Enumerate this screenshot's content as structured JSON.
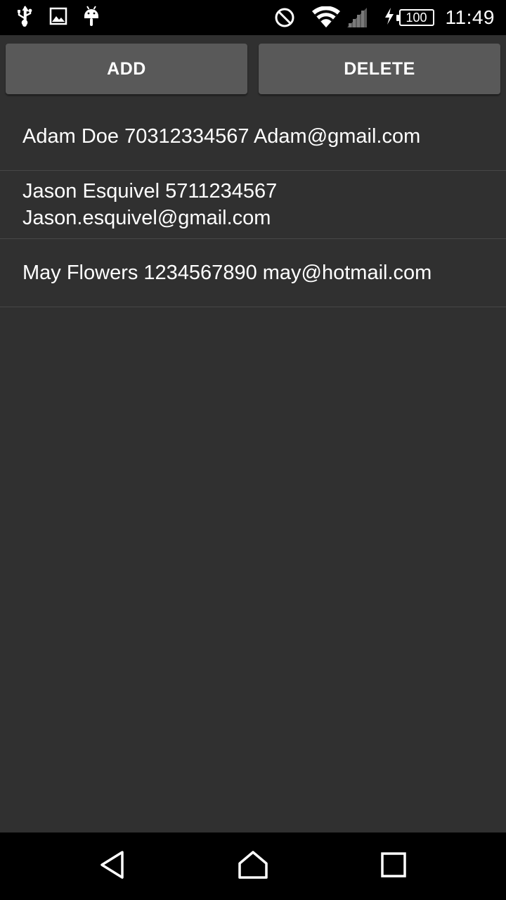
{
  "status_bar": {
    "time": "11:49",
    "battery_level": "100",
    "icons_left": [
      "usb-icon",
      "image-notification-icon",
      "android-debug-icon"
    ],
    "icons_right": [
      "do-not-disturb-icon",
      "wifi-icon",
      "cell-signal-icon",
      "charging-icon",
      "battery-icon"
    ]
  },
  "actions": {
    "add_label": "ADD",
    "delete_label": "DELETE"
  },
  "contacts": [
    {
      "text": "Adam Doe 70312334567 Adam@gmail.com"
    },
    {
      "text": "Jason Esquivel 5711234567 Jason.esquivel@gmail.com"
    },
    {
      "text": "May Flowers 1234567890 may@hotmail.com"
    }
  ],
  "nav_bar": {
    "icons": [
      "back-icon",
      "home-icon",
      "recents-icon"
    ]
  },
  "colors": {
    "background": "#303030",
    "button": "#595959",
    "bars": "#000000",
    "divider": "#474747",
    "text": "#ffffff"
  }
}
